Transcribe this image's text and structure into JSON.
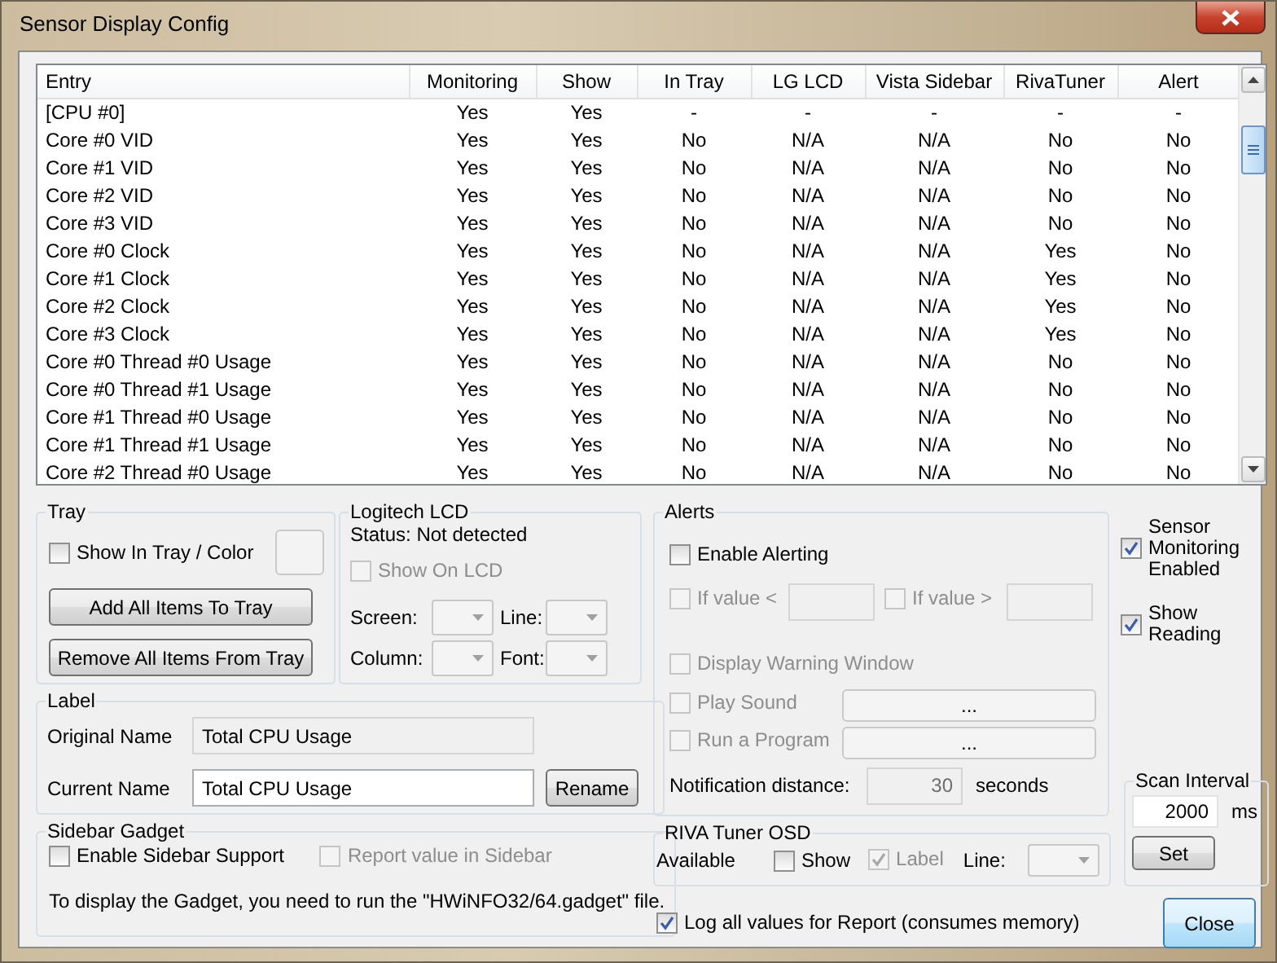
{
  "window": {
    "title": "Sensor Display Config"
  },
  "table": {
    "columns": [
      "Entry",
      "Monitoring",
      "Show",
      "In Tray",
      "LG LCD",
      "Vista Sidebar",
      "RivaTuner",
      "Alert"
    ],
    "rows": [
      [
        "[CPU #0]",
        "Yes",
        "Yes",
        "-",
        "-",
        "-",
        "-",
        "-"
      ],
      [
        "Core #0 VID",
        "Yes",
        "Yes",
        "No",
        "N/A",
        "N/A",
        "No",
        "No"
      ],
      [
        "Core #1 VID",
        "Yes",
        "Yes",
        "No",
        "N/A",
        "N/A",
        "No",
        "No"
      ],
      [
        "Core #2 VID",
        "Yes",
        "Yes",
        "No",
        "N/A",
        "N/A",
        "No",
        "No"
      ],
      [
        "Core #3 VID",
        "Yes",
        "Yes",
        "No",
        "N/A",
        "N/A",
        "No",
        "No"
      ],
      [
        "Core #0 Clock",
        "Yes",
        "Yes",
        "No",
        "N/A",
        "N/A",
        "Yes",
        "No"
      ],
      [
        "Core #1 Clock",
        "Yes",
        "Yes",
        "No",
        "N/A",
        "N/A",
        "Yes",
        "No"
      ],
      [
        "Core #2 Clock",
        "Yes",
        "Yes",
        "No",
        "N/A",
        "N/A",
        "Yes",
        "No"
      ],
      [
        "Core #3 Clock",
        "Yes",
        "Yes",
        "No",
        "N/A",
        "N/A",
        "Yes",
        "No"
      ],
      [
        "Core #0 Thread #0 Usage",
        "Yes",
        "Yes",
        "No",
        "N/A",
        "N/A",
        "No",
        "No"
      ],
      [
        "Core #0 Thread #1 Usage",
        "Yes",
        "Yes",
        "No",
        "N/A",
        "N/A",
        "No",
        "No"
      ],
      [
        "Core #1 Thread #0 Usage",
        "Yes",
        "Yes",
        "No",
        "N/A",
        "N/A",
        "No",
        "No"
      ],
      [
        "Core #1 Thread #1 Usage",
        "Yes",
        "Yes",
        "No",
        "N/A",
        "N/A",
        "No",
        "No"
      ],
      [
        "Core #2 Thread #0 Usage",
        "Yes",
        "Yes",
        "No",
        "N/A",
        "N/A",
        "No",
        "No"
      ]
    ]
  },
  "tray": {
    "title": "Tray",
    "show_in_tray": {
      "label": "Show In Tray / Color",
      "checked": false,
      "disabled": false
    },
    "buttons": [
      "Add All Items To Tray",
      "Remove All Items From Tray"
    ]
  },
  "logitech_lcd": {
    "title": "Logitech LCD",
    "status": "Status: Not detected",
    "show_on_lcd": {
      "label": "Show On LCD",
      "checked": false,
      "disabled": true
    },
    "fields": [
      "Screen:",
      "Line:",
      "Column:",
      "Font:"
    ]
  },
  "label": {
    "title": "Label",
    "original_name": {
      "label": "Original Name",
      "value": "Total CPU Usage"
    },
    "current_name": {
      "label": "Current Name",
      "value": "Total CPU Usage"
    },
    "rename_button": "Rename"
  },
  "sidebar_gadget": {
    "title": "Sidebar Gadget",
    "enable": {
      "label": "Enable Sidebar Support",
      "checked": false,
      "disabled": false
    },
    "report": {
      "label": "Report value in Sidebar",
      "checked": false,
      "disabled": true
    },
    "note": "To display the Gadget, you need to run the \"HWiNFO32/64.gadget\" file."
  },
  "alerts": {
    "title": "Alerts",
    "enable": {
      "label": "Enable Alerting",
      "checked": false,
      "disabled": false
    },
    "if_below": {
      "label": "If value <",
      "checked": false,
      "disabled": true
    },
    "if_above": {
      "label": "If value >",
      "checked": false,
      "disabled": true
    },
    "display_warning": {
      "label": "Display Warning Window",
      "checked": false,
      "disabled": true
    },
    "play_sound": {
      "label": "Play Sound",
      "checked": false,
      "disabled": true,
      "button": "..."
    },
    "run_program": {
      "label": "Run a Program",
      "checked": false,
      "disabled": true,
      "button": "..."
    },
    "notification_label": "Notification distance:",
    "notification_value": "30",
    "notification_unit": "seconds"
  },
  "riva_osd": {
    "title": "RIVA Tuner OSD",
    "status": "Available",
    "show": {
      "label": "Show",
      "checked": false,
      "disabled": false
    },
    "label": {
      "label": "Label",
      "checked": true,
      "disabled": true
    },
    "line_label": "Line:"
  },
  "log_all": {
    "label": "Log all values for Report (consumes memory)",
    "checked": true,
    "disabled": false
  },
  "sensor_monitoring": {
    "label": "Sensor Monitoring Enabled",
    "checked": true,
    "disabled": false
  },
  "show_reading": {
    "label": "Show Reading",
    "checked": true,
    "disabled": false
  },
  "scan_interval": {
    "title": "Scan Interval",
    "value": "2000",
    "unit": "ms",
    "button": "Set"
  },
  "close_button": "Close"
}
